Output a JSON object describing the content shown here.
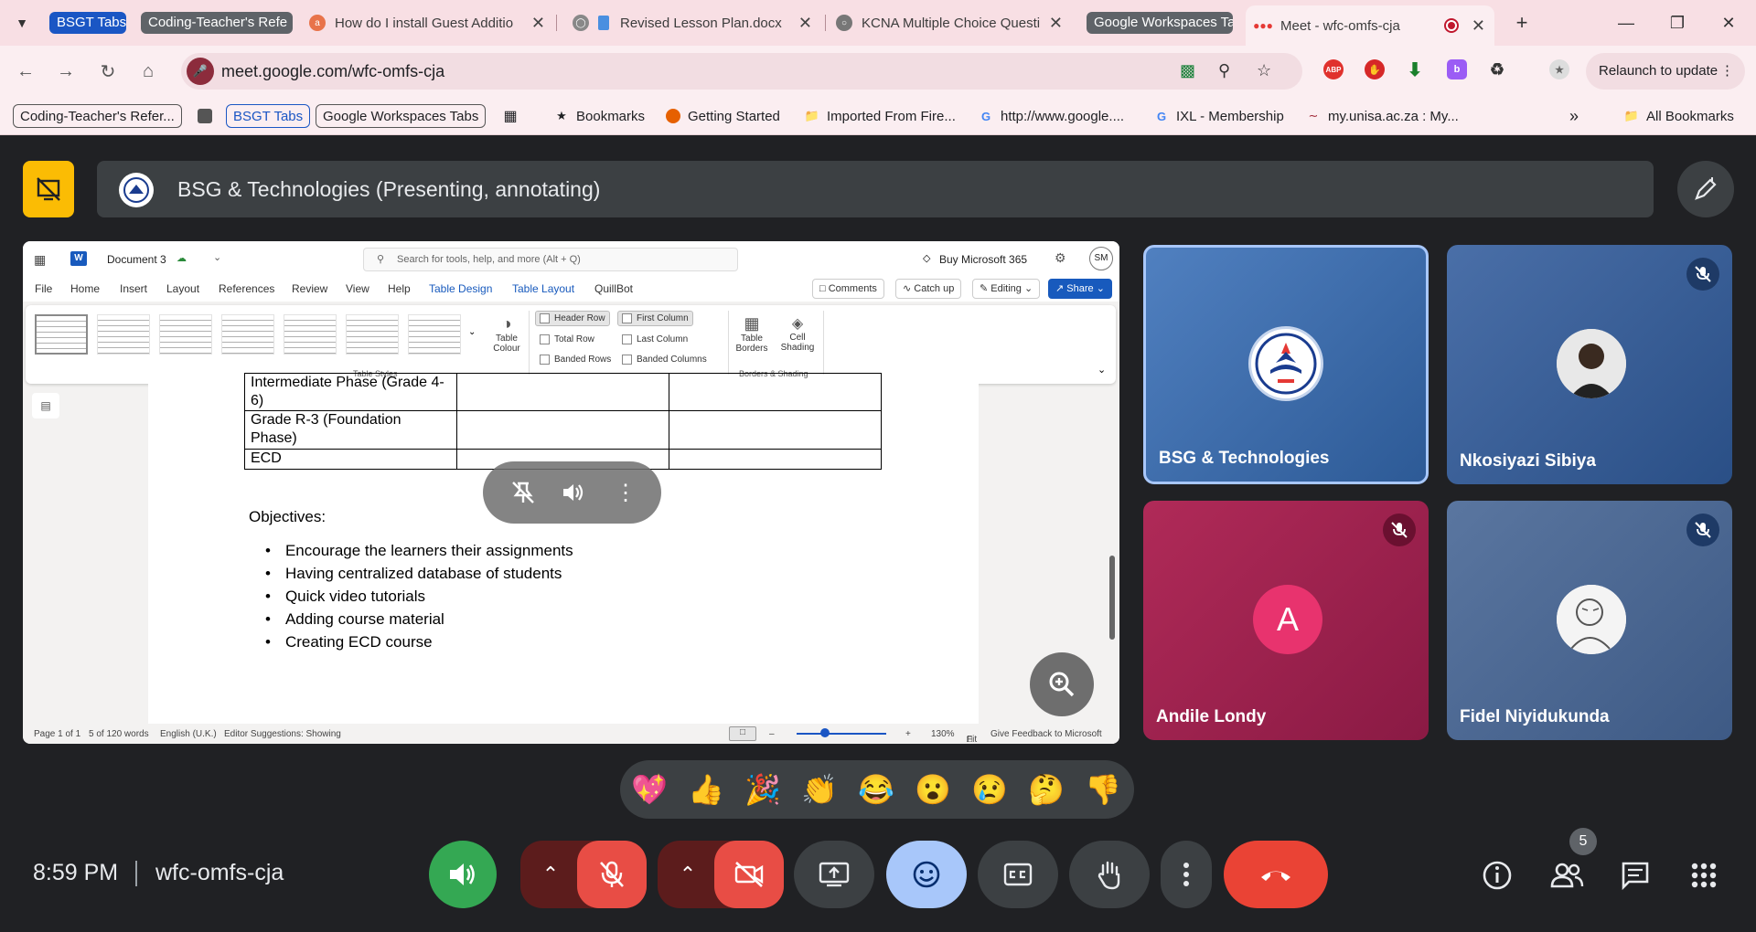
{
  "browser": {
    "tab_groups": [
      {
        "label": "BSGT Tabs",
        "color": "#1a56c4"
      },
      {
        "label": "Coding-Teacher's Refe",
        "color": "#5f6368"
      },
      {
        "label": "Google Workspaces Ta",
        "color": "#5f6368"
      }
    ],
    "tabs": [
      {
        "title": "How do I install Guest Additio",
        "icon": "ask-icon"
      },
      {
        "title": "Revised Lesson Plan.docx",
        "icon": "doc-icon"
      },
      {
        "title": "KCNA Multiple Choice Questi",
        "icon": "globe-icon"
      },
      {
        "title": "Meet - wfc-omfs-cja",
        "icon": "meet-icon",
        "active": true
      }
    ],
    "url": "meet.google.com/wfc-omfs-cja",
    "relaunch_label": "Relaunch to update",
    "extensions": [
      "ABP",
      "stop-icon",
      "download-icon",
      "b",
      "puzzle-icon"
    ],
    "bookmarks": [
      {
        "label": "Coding-Teacher's Refer...",
        "style": "box"
      },
      {
        "label": "BSGT Tabs",
        "style": "box-blue"
      },
      {
        "label": "Google Workspaces Tabs",
        "style": "box"
      },
      {
        "label": "Bookmarks",
        "icon": "star-icon"
      },
      {
        "label": "Getting Started",
        "icon": "firefox-icon"
      },
      {
        "label": "Imported From Fire...",
        "icon": "folder-icon"
      },
      {
        "label": "http://www.google....",
        "icon": "google-icon"
      },
      {
        "label": "IXL - Membership",
        "icon": "google-icon"
      },
      {
        "label": "my.unisa.ac.za : My...",
        "icon": "unisa-icon"
      }
    ],
    "all_bookmarks": "All Bookmarks"
  },
  "meet": {
    "presenting_title": "BSG & Technologies (Presenting, annotating)",
    "time": "8:59 PM",
    "meeting_code": "wfc-omfs-cja",
    "people_count": "5",
    "participants": [
      {
        "name": "BSG & Technologies",
        "bg": "#3f6fae",
        "muted": false,
        "avatar": "logo"
      },
      {
        "name": "Nkosiyazi Sibiya",
        "bg": "#3a5f96",
        "muted": true,
        "avatar": "photo"
      },
      {
        "name": "Andile Londy",
        "bg": "#a3204e",
        "muted": true,
        "avatar": "A"
      },
      {
        "name": "Fidel Niyidukunda",
        "bg": "#4d6891",
        "muted": true,
        "avatar": "sketch"
      }
    ],
    "reactions": [
      "💖",
      "👍",
      "🎉",
      "👏",
      "😂",
      "😮",
      "😢",
      "🤔",
      "👎"
    ]
  },
  "word": {
    "doc_name": "Document 3",
    "search_placeholder": "Search for tools, help, and more (Alt + Q)",
    "buy": "Buy Microsoft 365",
    "avatar": "SM",
    "menu": [
      "File",
      "Home",
      "Insert",
      "Layout",
      "References",
      "Review",
      "View",
      "Help",
      "Table Design",
      "Table Layout",
      "QuillBot"
    ],
    "buttons": {
      "comments": "Comments",
      "catchup": "Catch up",
      "editing": "Editing",
      "share": "Share"
    },
    "ribbon": {
      "table_styles": "Table Styles",
      "table_colour": "Table Colour",
      "options": [
        "Header Row",
        "Total Row",
        "Banded Rows",
        "First Column",
        "Last Column",
        "Banded Columns"
      ],
      "table_borders": "Table Borders",
      "cell_shading": "Cell Shading",
      "borders_group": "Borders & Shading"
    },
    "table_rows": [
      [
        "Intermediate Phase (Grade 4-6)",
        "",
        ""
      ],
      [
        "Grade R-3 (Foundation Phase)",
        "",
        ""
      ],
      [
        "ECD",
        "",
        ""
      ]
    ],
    "objectives_heading": "Objectives:",
    "objectives": [
      "Encourage the learners their assignments",
      "Having centralized database of students",
      "Quick video tutorials",
      "Adding course material",
      "Creating ECD course"
    ],
    "status": {
      "page": "Page 1 of 1",
      "words": "5 of 120 words",
      "language": "English (U.K.)",
      "suggestions": "Editor Suggestions: Showing",
      "zoom": "130%",
      "fit": "Fit",
      "feedback": "Give Feedback to Microsoft"
    }
  }
}
